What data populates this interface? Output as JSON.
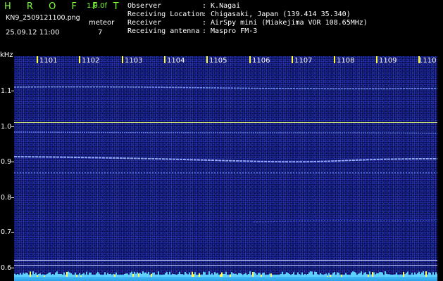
{
  "header": {
    "app_title": "H R O F F T",
    "version": "1.0.0f",
    "filename": "KN9_2509121100.png",
    "mode_label": "meteor",
    "mode_value": "7",
    "timestamp": "25.09.12 11:00"
  },
  "info": [
    {
      "key": "Observer",
      "value": ": K.Nagai"
    },
    {
      "key": "Receiving Location",
      "value": ": Chigasaki, Japan (139.414 35.340)"
    },
    {
      "key": "Receiver",
      "value": ": AirSpy mini (Miakejima VOR 108.65MHz)"
    },
    {
      "key": "Receiving antenna",
      "value": ": Maspro FM-3"
    }
  ],
  "axis": {
    "unit": "kHz",
    "time_labels": [
      "1101",
      "1102",
      "1103",
      "1104",
      "1105",
      "1106",
      "1107",
      "1108",
      "1109",
      "1110"
    ],
    "freq_labels": [
      "1.1",
      "1.0",
      "0.9",
      "0.8",
      "0.7",
      "0.6"
    ]
  },
  "colors": {
    "header_green": "#7bff3a",
    "background": "#0a0f5a",
    "tick_yellow": "#ffff3a",
    "reference_line": "#e0f080",
    "carrier_trace": "#8aa8ff"
  }
}
